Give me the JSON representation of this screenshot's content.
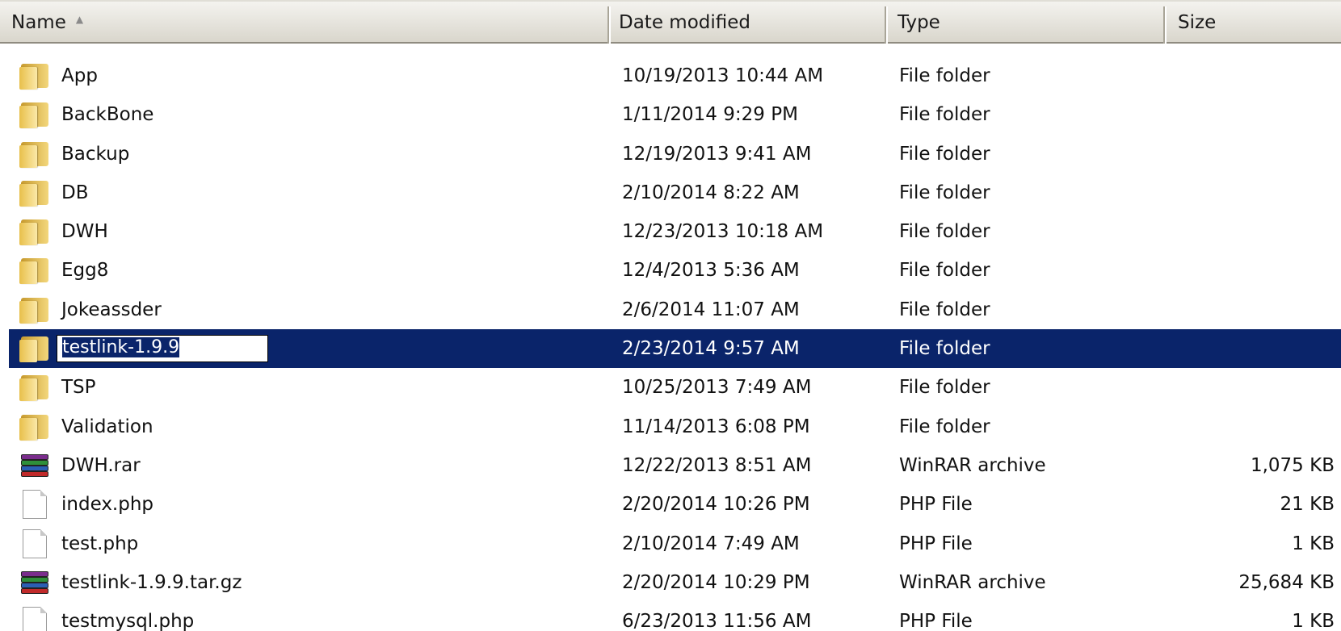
{
  "columns": {
    "name": "Name",
    "date": "Date modified",
    "type": "Type",
    "size": "Size"
  },
  "sort": {
    "column": "name",
    "direction": "ascending",
    "icon": "sort-up-arrow-icon"
  },
  "rename": {
    "editing": true,
    "value": "testlink-1.9.9"
  },
  "colors": {
    "selection": "#0a246a",
    "header": "#d9d6cc"
  },
  "files": [
    {
      "icon": "folder-icon",
      "name": "App",
      "date": "10/19/2013 10:44 AM",
      "type": "File folder",
      "size": "",
      "selected": false
    },
    {
      "icon": "folder-icon",
      "name": "BackBone",
      "date": "1/11/2014 9:29 PM",
      "type": "File folder",
      "size": "",
      "selected": false
    },
    {
      "icon": "folder-icon",
      "name": "Backup",
      "date": "12/19/2013 9:41 AM",
      "type": "File folder",
      "size": "",
      "selected": false
    },
    {
      "icon": "folder-icon",
      "name": "DB",
      "date": "2/10/2014 8:22 AM",
      "type": "File folder",
      "size": "",
      "selected": false
    },
    {
      "icon": "folder-icon",
      "name": "DWH",
      "date": "12/23/2013 10:18 AM",
      "type": "File folder",
      "size": "",
      "selected": false
    },
    {
      "icon": "folder-icon",
      "name": "Egg8",
      "date": "12/4/2013 5:36 AM",
      "type": "File folder",
      "size": "",
      "selected": false
    },
    {
      "icon": "folder-icon",
      "name": "Jokeassder",
      "date": "2/6/2014 11:07 AM",
      "type": "File folder",
      "size": "",
      "selected": false
    },
    {
      "icon": "folder-icon",
      "name": "testlink-1.9.9",
      "date": "2/23/2014 9:57 AM",
      "type": "File folder",
      "size": "",
      "selected": true
    },
    {
      "icon": "folder-icon",
      "name": "TSP",
      "date": "10/25/2013 7:49 AM",
      "type": "File folder",
      "size": "",
      "selected": false
    },
    {
      "icon": "folder-icon",
      "name": "Validation",
      "date": "11/14/2013 6:08 PM",
      "type": "File folder",
      "size": "",
      "selected": false
    },
    {
      "icon": "winrar-archive-icon",
      "name": "DWH.rar",
      "date": "12/22/2013 8:51 AM",
      "type": "WinRAR archive",
      "size": "1,075 KB",
      "selected": false
    },
    {
      "icon": "file-icon",
      "name": "index.php",
      "date": "2/20/2014 10:26 PM",
      "type": "PHP File",
      "size": "21 KB",
      "selected": false
    },
    {
      "icon": "file-icon",
      "name": "test.php",
      "date": "2/10/2014 7:49 AM",
      "type": "PHP File",
      "size": "1 KB",
      "selected": false
    },
    {
      "icon": "winrar-archive-icon",
      "name": "testlink-1.9.9.tar.gz",
      "date": "2/20/2014 10:29 PM",
      "type": "WinRAR archive",
      "size": "25,684 KB",
      "selected": false
    },
    {
      "icon": "file-icon",
      "name": "testmysql.php",
      "date": "6/23/2013 11:56 AM",
      "type": "PHP File",
      "size": "1 KB",
      "selected": false
    }
  ]
}
